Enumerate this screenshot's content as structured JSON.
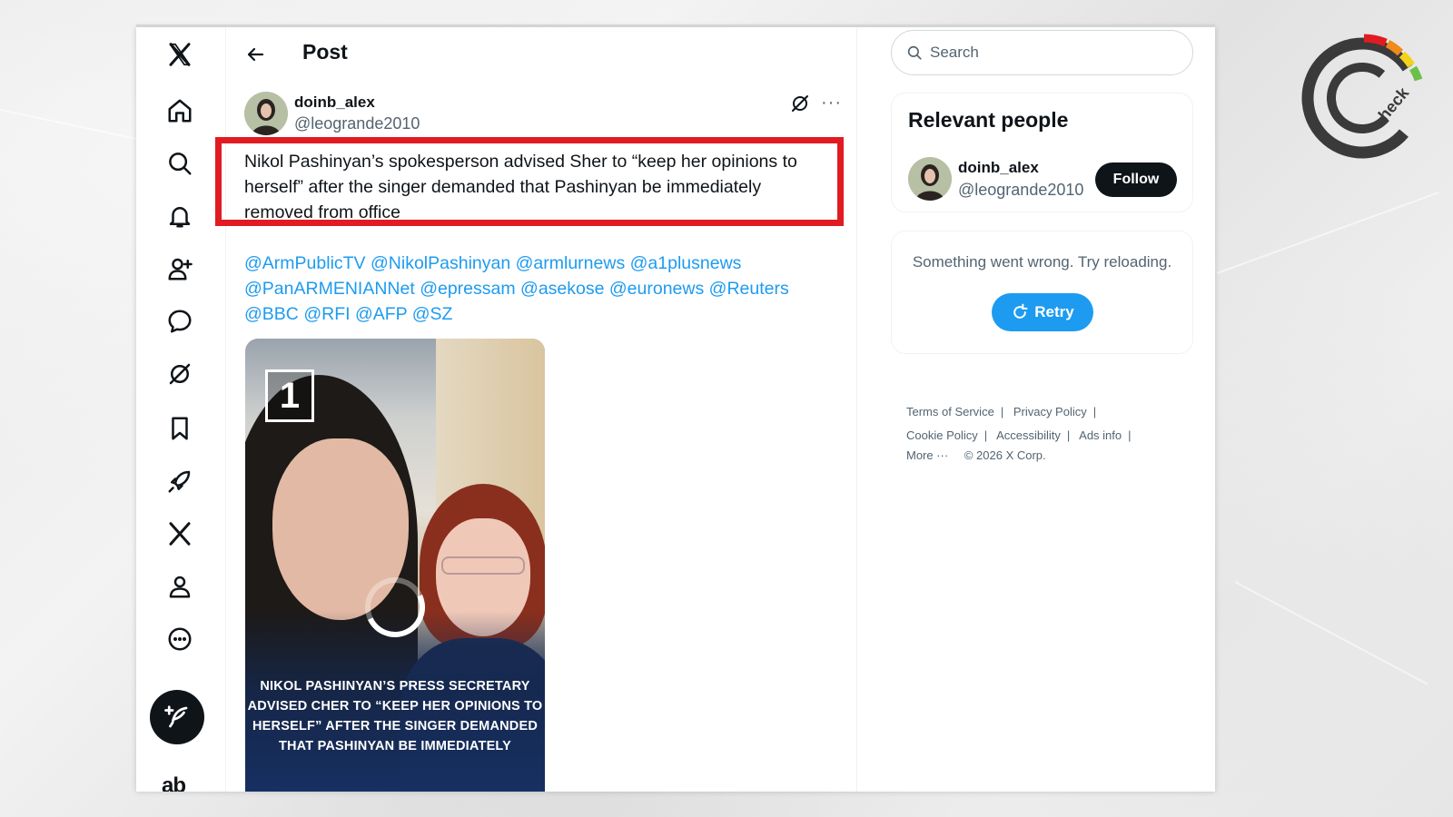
{
  "nav": {
    "items": [
      "x-logo",
      "home",
      "explore",
      "notifications",
      "follow",
      "messages",
      "grok",
      "bookmarks",
      "jobs",
      "premium",
      "profile",
      "more"
    ],
    "compose_label": "Post",
    "partial_text": "ab"
  },
  "header": {
    "back_label": "Back",
    "title": "Post"
  },
  "post": {
    "author_name": "doinb_alex",
    "author_handle": "@leogrande2010",
    "text": "Nikol Pashinyan’s spokesperson advised Sher to “keep her opinions to herself” after the singer demanded that Pashinyan be immediately removed from office",
    "mentions": [
      "@ArmPublicTV",
      "@NikolPashinyan",
      "@armlurnews",
      "@a1plusnews",
      "@PanARMENIANNet",
      "@epressam",
      "@asekose",
      "@euronews",
      "@Reuters",
      "@BBC",
      "@RFI",
      "@AFP",
      "@SZ"
    ],
    "media": {
      "logo_text": "1",
      "caption": "NIKOL PASHINYAN’S PRESS SECRETARY ADVISED CHER TO “KEEP HER OPINIONS TO HERSELF” AFTER THE SINGER DEMANDED THAT PASHINYAN BE IMMEDIATELY"
    }
  },
  "sidebar": {
    "search_placeholder": "Search",
    "relevant": {
      "title": "Relevant people",
      "name": "doinb_alex",
      "handle": "@leogrande2010",
      "follow_label": "Follow"
    },
    "error": {
      "message": "Something went wrong. Try reloading.",
      "retry_label": "Retry"
    },
    "footer": {
      "terms": "Terms of Service",
      "privacy": "Privacy Policy",
      "cookie": "Cookie Policy",
      "accessibility": "Accessibility",
      "ads": "Ads info",
      "more": "More ···",
      "copyright": "© 2026 X Corp."
    }
  },
  "colors": {
    "accent": "#1d9bf0",
    "highlight": "#e11b22",
    "text": "#0f1419",
    "secondary": "#536471"
  }
}
